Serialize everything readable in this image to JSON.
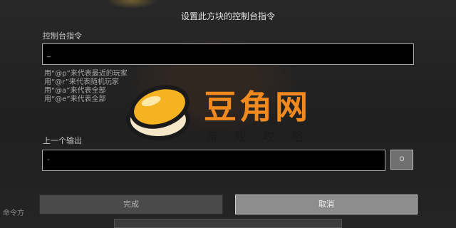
{
  "screen": {
    "title": "设置此方块的控制台指令"
  },
  "command": {
    "label": "控制台指令",
    "value": "_"
  },
  "hints": [
    "用“@p”来代表最近的玩家",
    "用“@r”来代表随机玩家",
    "用“@a”来代表全部",
    "用“@e”来代表全部"
  ],
  "previous_output": {
    "label": "上一个输出",
    "value": "-",
    "toggle_label": "O"
  },
  "buttons": {
    "done": "完成",
    "cancel": "取消"
  },
  "corner_label": "命令方",
  "watermark": {
    "title": "豆角网",
    "subtitle": "游戏攻略"
  },
  "colors": {
    "input_bg": "#000000",
    "button_active": "#8d8d8d",
    "button_disabled": "#4a4a4a",
    "watermark_orange": "#f08a1e"
  }
}
